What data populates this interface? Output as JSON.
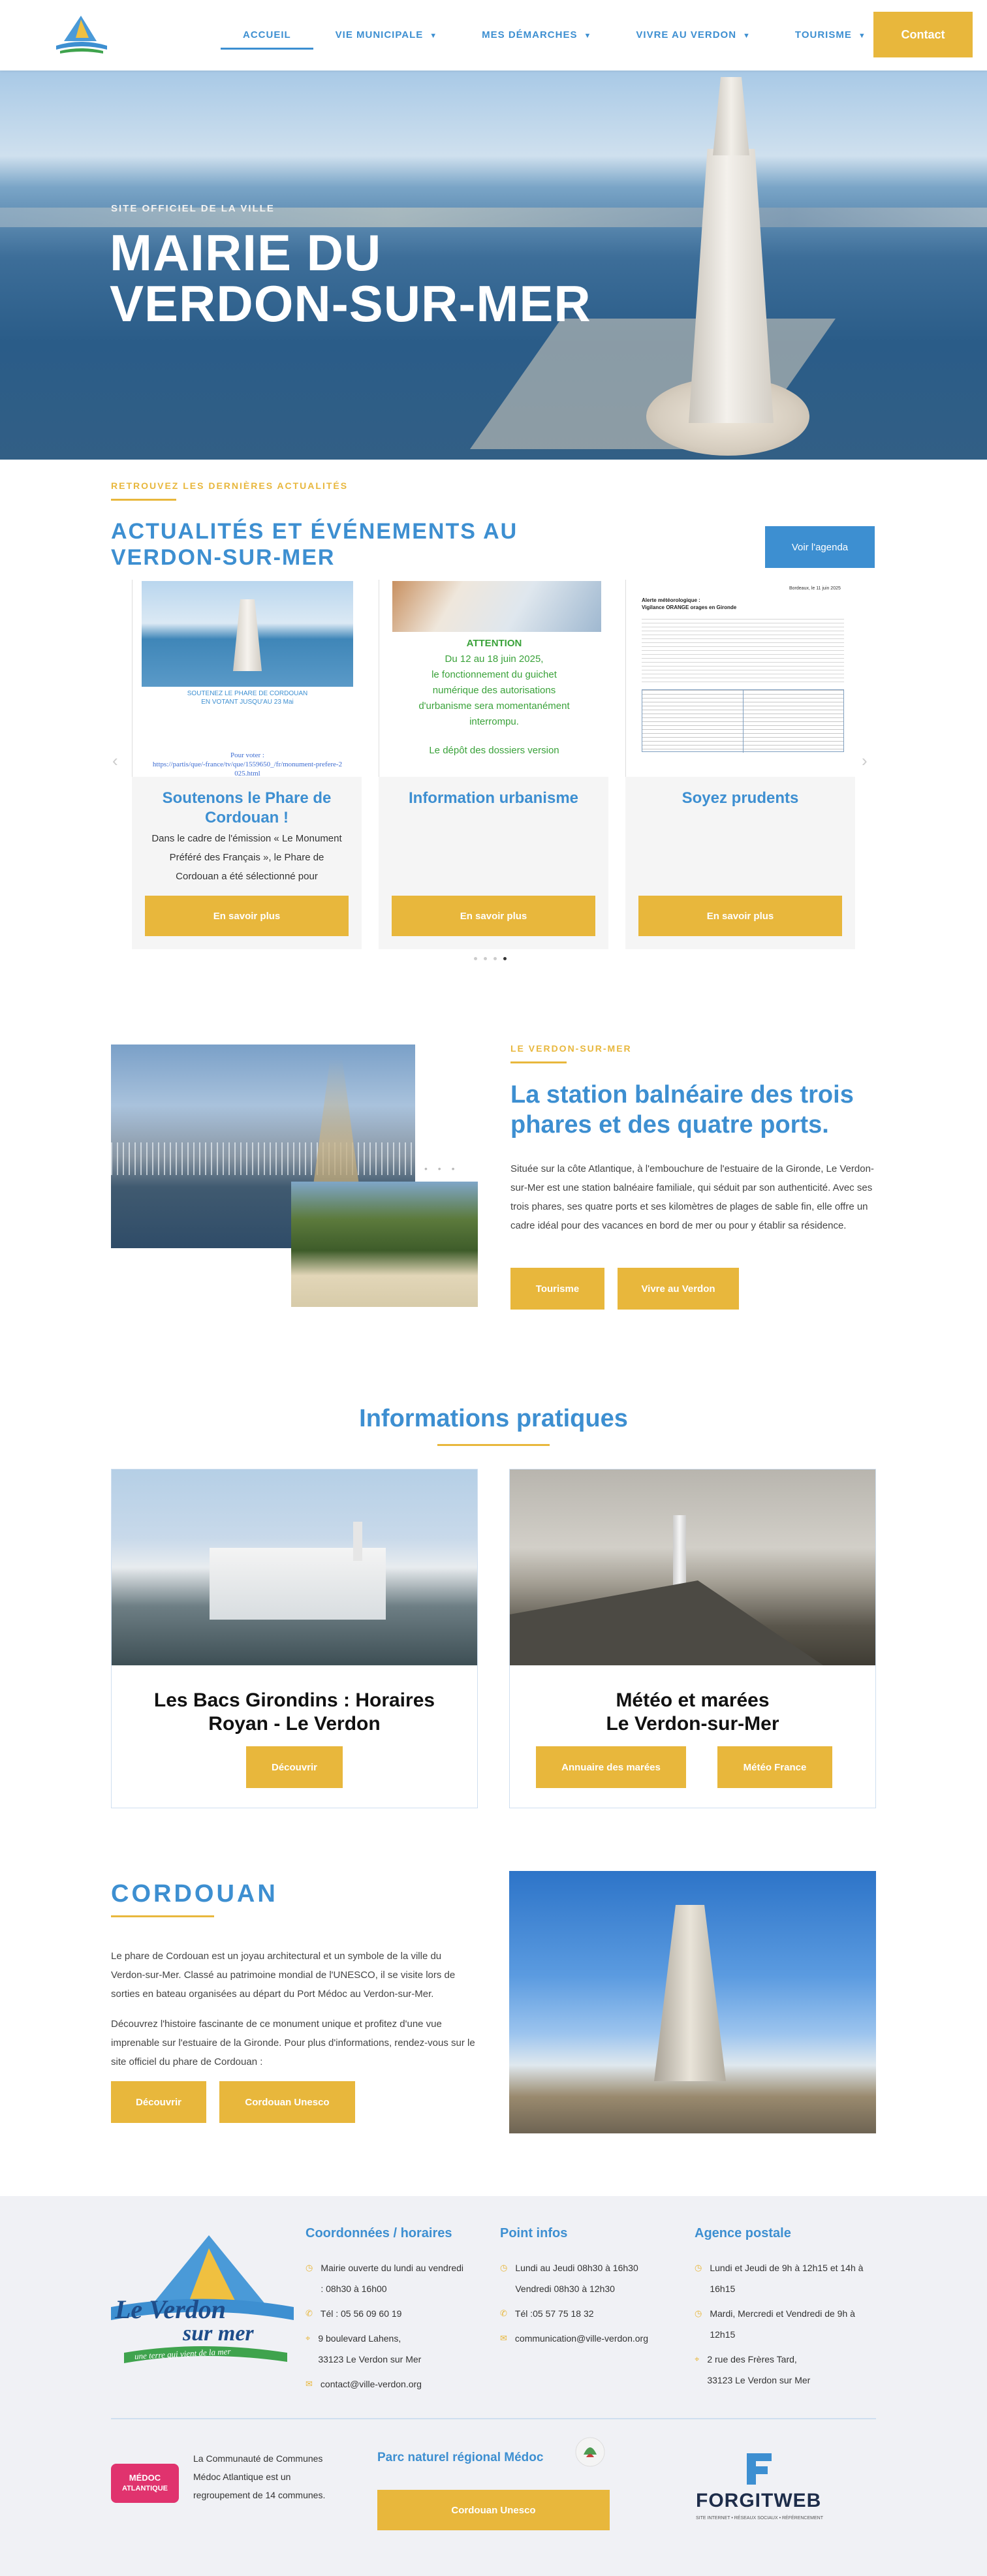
{
  "header": {
    "nav": [
      {
        "label": "ACCUEIL"
      },
      {
        "label": "VIE MUNICIPALE"
      },
      {
        "label": "MES DÉMARCHES"
      },
      {
        "label": "VIVRE AU VERDON"
      },
      {
        "label": "TOURISME"
      }
    ],
    "contact_label": "Contact"
  },
  "hero": {
    "subtitle": "SITE OFFICIEL DE LA VILLE",
    "title_line1": "MAIRIE DU",
    "title_line2": "VERDON-SUR-MER"
  },
  "news": {
    "eyebrow": "RETROUVEZ LES DERNIÈRES ACTUALITÉS",
    "title_line1": "ACTUALITÉS ET ÉVÉNEMENTS AU",
    "title_line2": "VERDON-SUR-MER",
    "agenda_label": "Voir l'agenda",
    "cards": [
      {
        "img_caption1": "SOUTENEZ LE PHARE DE CORDOUAN",
        "img_caption2": "EN VOTANT JUSQU'AU 23 Mai",
        "img_vote": "Pour voter :",
        "img_link": "https://partis/que/-france/tv/que/1559650_/fr/monument-prefere-2025.html",
        "title_line1": "Soutenons le Phare de",
        "title_line2": "Cordouan !",
        "text": "Dans le cadre de l'émission « Le Monument Préféré des Français », le Phare de Cordouan a été sélectionné pour",
        "button": "En savoir plus"
      },
      {
        "img_attention": "ATTENTION",
        "img_line1": "Du 12 au 18 juin 2025,",
        "img_line2": "le fonctionnement du guichet",
        "img_line3": "numérique des autorisations",
        "img_line4": "d'urbanisme sera momentanément",
        "img_line5": "interrompu.",
        "img_line6": "Le dépôt des dossiers version",
        "title_line1": "Information urbanisme",
        "button": "En savoir plus"
      },
      {
        "img_doc_title": "Alerte météorologique :",
        "img_doc_sub": "Vigilance ORANGE orages en Gironde",
        "img_doc_date": "Bordeaux, le 11 juin 2025",
        "title_line1": "Soyez prudents",
        "button": "En savoir plus"
      }
    ]
  },
  "station": {
    "eyebrow": "LE VERDON-SUR-MER",
    "title_line1": "La station balnéaire des trois",
    "title_line2": "phares et des quatre ports.",
    "text": "Située sur la côte Atlantique, à l'embouchure de l'estuaire de la Gironde, Le Verdon-sur-Mer est une station balnéaire familiale, qui séduit par son authenticité. Avec ses trois phares, ses quatre ports et ses kilomètres de plages de sable fin, elle offre un cadre idéal pour des vacances en bord de mer ou pour y établir sa résidence.",
    "btn_tourisme": "Tourisme",
    "btn_vivre": "Vivre au Verdon"
  },
  "infos": {
    "title": "Informations pratiques",
    "card1": {
      "title_line1": "Les Bacs Girondins : Horaires",
      "title_line2": "Royan - Le Verdon",
      "button": "Découvrir"
    },
    "card2": {
      "title_line1": "Météo et marées",
      "title_line2": "Le Verdon-sur-Mer",
      "button1": "Annuaire des marées",
      "button2": "Météo France"
    }
  },
  "cordouan": {
    "title": "CORDOUAN",
    "p1": "Le phare de Cordouan est un joyau architectural et un symbole de la ville du Verdon-sur-Mer. Classé au patrimoine mondial de l'UNESCO, il se visite lors de sorties en bateau organisées au départ du Port Médoc au Verdon-sur-Mer.",
    "p2": "Découvrez l'histoire fascinante de ce monument unique et profitez d'une vue imprenable sur l'estuaire de la Gironde. Pour plus d'informations, rendez-vous sur le site officiel du phare de Cordouan :",
    "btn1": "Découvrir",
    "btn2": "Cordouan Unesco"
  },
  "footer": {
    "logo_text1": "Le Verdon",
    "logo_text2": "sur mer",
    "logo_tagline": "une terre qui vient de la mer",
    "col1": {
      "title": "Coordonnées / horaires",
      "hours_line1": "Mairie ouverte du lundi au vendredi",
      "hours_line2": ": 08h30 à 16h00",
      "phone": "Tél : 05 56 09 60 19",
      "addr1": "9 boulevard Lahens,",
      "addr2": "33123 Le Verdon sur Mer",
      "email": "contact@ville-verdon.org"
    },
    "col2": {
      "title": "Point infos",
      "line1": "Lundi au Jeudi 08h30 à 16h30",
      "line2": "Vendredi 08h30 à 12h30",
      "phone": "Tél :05 57 75 18 32",
      "email": "communication@ville-verdon.org"
    },
    "col3": {
      "title": "Agence postale",
      "line1": "Lundi et Jeudi de 9h à 12h15 et 14h à",
      "line2": "16h15",
      "line3": "Mardi, Mercredi et Vendredi de 9h à",
      "line4": "12h15",
      "line5": "2 rue des Frères Tard,",
      "line6": "33123 Le Verdon sur Mer"
    },
    "medoc_badge1": "MÉDOC",
    "medoc_badge2": "ATLANTIQUE",
    "medoc_text": "La Communauté de Communes Médoc Atlantique est un regroupement de 14 communes.",
    "parc_title": "Parc naturel régional Médoc",
    "parc_button": "Cordouan Unesco",
    "forgit_name": "FORGITWEB",
    "forgit_tagline": "SITE INTERNET • RÉSEAUX SOCIAUX • RÉFÉRENCEMENT"
  },
  "colors": {
    "accent_yellow": "#e8b73c",
    "brand_blue": "#3d8fd1"
  }
}
